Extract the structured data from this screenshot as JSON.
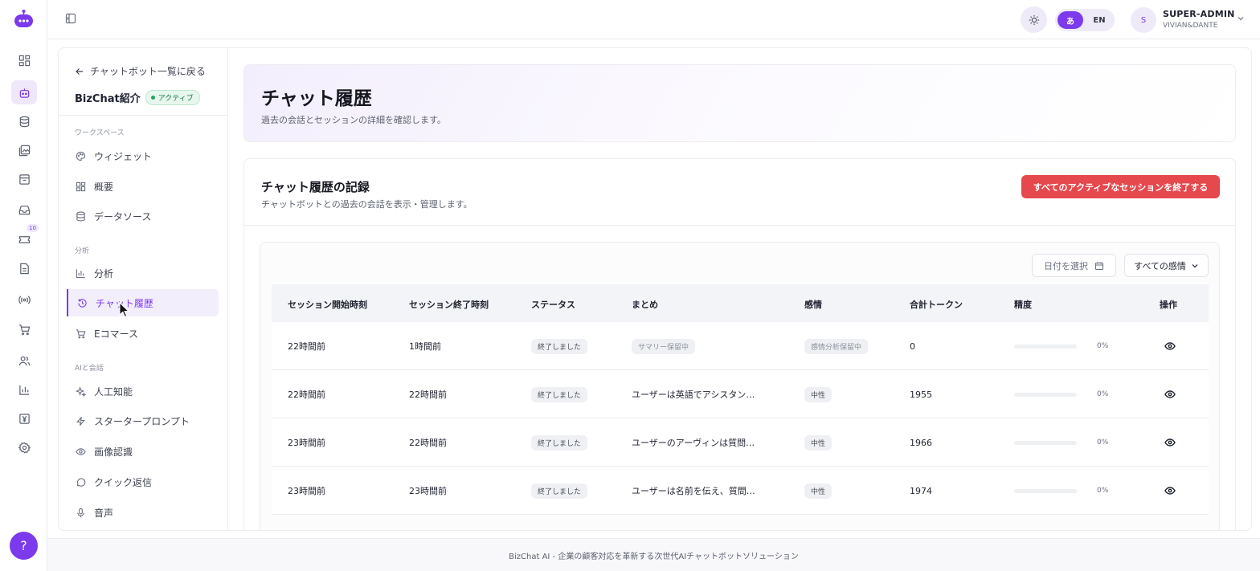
{
  "rail": {
    "help_label": "?",
    "badge_count": "10"
  },
  "topbar": {
    "lang_ja": "あ",
    "lang_en": "EN",
    "user_initial": "S",
    "user_name": "SUPER-ADMIN",
    "user_org": "VIVIAN&DANTE"
  },
  "sidebar": {
    "back_label": "チャットボット一覧に戻る",
    "bot_name": "BizChat紹介",
    "status_label": "アクティブ",
    "section_workspace": "ワークスペース",
    "section_analytics": "分析",
    "section_ai": "AIと会話",
    "items": [
      {
        "label": "ウィジェット"
      },
      {
        "label": "概要"
      },
      {
        "label": "データソース"
      },
      {
        "label": "分析"
      },
      {
        "label": "チャット履歴"
      },
      {
        "label": "Eコマース"
      },
      {
        "label": "人工知能"
      },
      {
        "label": "スタータープロンプト"
      },
      {
        "label": "画像認識"
      },
      {
        "label": "クイック返信"
      },
      {
        "label": "音声"
      }
    ]
  },
  "page": {
    "title": "チャット履歴",
    "subtitle": "過去の会話とセッションの詳細を確認します。"
  },
  "card": {
    "title": "チャット履歴の記録",
    "subtitle": "チャットボットとの過去の会話を表示・管理します。",
    "end_button": "すべてのアクティブなセッションを終了する",
    "date_placeholder": "日付を選択",
    "sentiment_filter": "すべての感情"
  },
  "table": {
    "headers": [
      "セッション開始時刻",
      "セッション終了時刻",
      "ステータス",
      "まとめ",
      "感情",
      "合計トークン",
      "精度",
      "操作"
    ],
    "rows": [
      {
        "start": "22時間前",
        "end": "1時間前",
        "status": "終了しました",
        "summary": "サマリー保留中",
        "sentiment": "感情分析保留中",
        "tokens": "0",
        "accuracy": "0%"
      },
      {
        "start": "22時間前",
        "end": "22時間前",
        "status": "終了しました",
        "summary": "ユーザーは英語でアシスタン…",
        "sentiment": "中性",
        "tokens": "1955",
        "accuracy": "0%"
      },
      {
        "start": "23時間前",
        "end": "22時間前",
        "status": "終了しました",
        "summary": "ユーザーのアーヴィンは質問…",
        "sentiment": "中性",
        "tokens": "1966",
        "accuracy": "0%"
      },
      {
        "start": "23時間前",
        "end": "23時間前",
        "status": "終了しました",
        "summary": "ユーザーは名前を伝え、質問…",
        "sentiment": "中性",
        "tokens": "1974",
        "accuracy": "0%"
      }
    ]
  },
  "footer": {
    "text": "BizChat AI - 企業の顧客対応を革新する次世代AIチャットボットソリューション"
  },
  "colors": {
    "accent": "#7c3aed",
    "danger": "#e5484d",
    "success": "#22a35a"
  }
}
